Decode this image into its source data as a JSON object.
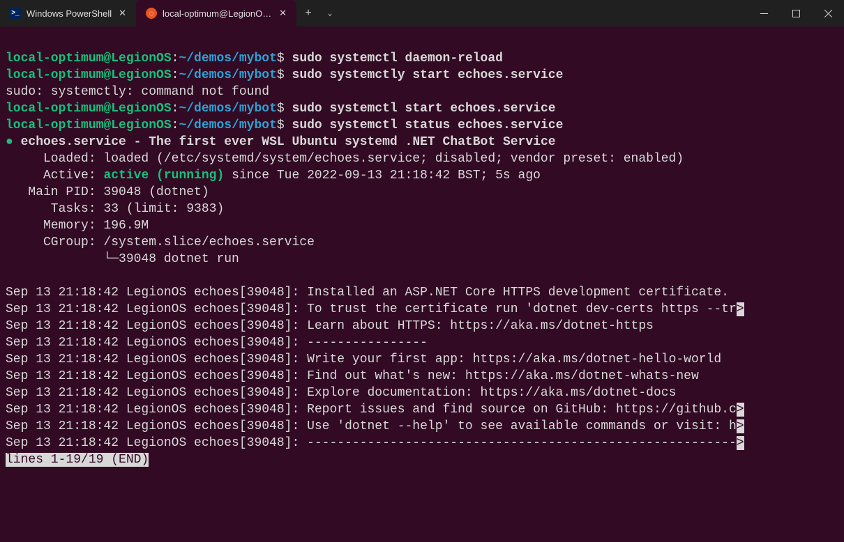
{
  "titlebar": {
    "tabs": [
      {
        "label": "Windows PowerShell",
        "icon": "powershell-icon",
        "active": false
      },
      {
        "label": "local-optimum@LegionOS: ~,",
        "icon": "ubuntu-icon",
        "active": true
      }
    ],
    "add_label": "+",
    "dropdown_label": "⌄"
  },
  "prompt": {
    "user": "local-optimum@LegionOS",
    "sep": ":",
    "path": "~/demos/mybot",
    "sigil": "$"
  },
  "commands": {
    "c1": "sudo systemctl daemon-reload",
    "c2": "sudo systemctly start echoes.service",
    "err": "sudo: systemctly: command not found",
    "c3": "sudo systemctl start echoes.service",
    "c4": "sudo systemctl status echoes.service"
  },
  "status": {
    "bullet": "●",
    "unit": "echoes.service - The first ever WSL Ubuntu systemd .NET ChatBot Service",
    "loaded": "     Loaded: loaded (/etc/systemd/system/echoes.service; disabled; vendor preset: enabled)",
    "active_lbl": "     Active: ",
    "active_val": "active (running)",
    "active_tail": " since Tue 2022-09-13 21:18:42 BST; 5s ago",
    "pid": "   Main PID: 39048 (dotnet)",
    "tasks": "      Tasks: 33 (limit: 9383)",
    "memory": "     Memory: 196.9M",
    "cgroup": "     CGroup: /system.slice/echoes.service",
    "cgline": "             └─39048 dotnet run"
  },
  "log_prefix": "Sep 13 21:18:42 LegionOS echoes[39048]: ",
  "logs": {
    "l1": "Installed an ASP.NET Core HTTPS development certificate.",
    "l2": "To trust the certificate run 'dotnet dev-certs https --tr",
    "l3": "Learn about HTTPS: https://aka.ms/dotnet-https",
    "l4": "----------------",
    "l5": "Write your first app: https://aka.ms/dotnet-hello-world",
    "l6": "Find out what's new: https://aka.ms/dotnet-whats-new",
    "l7": "Explore documentation: https://aka.ms/dotnet-docs",
    "l8": "Report issues and find source on GitHub: https://github.c",
    "l9": "Use 'dotnet --help' to see available commands or visit: h",
    "l10": "---------------------------------------------------------"
  },
  "trunc": ">",
  "pager": "lines 1-19/19 (END)"
}
